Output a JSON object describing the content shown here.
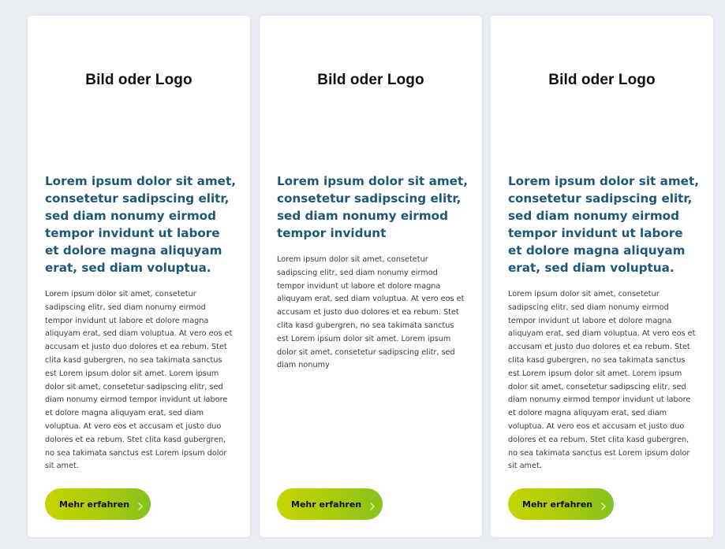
{
  "cards": [
    {
      "logo": "Bild oder Logo",
      "title": "Lorem ipsum dolor sit amet, consetetur sadipscing elitr, sed diam nonumy eirmod tempor invidunt ut labore et dolore magna aliquyam erat, sed diam voluptua.",
      "body": "Lorem ipsum dolor sit amet, consetetur sadipscing elitr, sed diam nonumy eirmod tempor invidunt ut labore et dolore magna aliquyam erat, sed diam voluptua. At vero eos et accusam et justo duo dolores et ea rebum. Stet clita kasd gubergren, no sea takimata sanctus est Lorem ipsum dolor sit amet. Lorem ipsum dolor sit amet, consetetur sadipscing elitr, sed diam nonumy eirmod tempor invidunt ut labore et dolore magna aliquyam erat, sed diam voluptua. At vero eos et accusam et justo duo dolores et ea rebum. Stet clita kasd gubergren, no sea takimata sanctus est Lorem ipsum dolor sit amet.",
      "button": "Mehr erfahren"
    },
    {
      "logo": "Bild oder Logo",
      "title": "Lorem ipsum dolor sit amet, consetetur sadipscing elitr, sed diam nonumy eirmod tempor invidunt",
      "body": "Lorem ipsum dolor sit amet, consetetur sadipscing elitr, sed diam nonumy eirmod tempor invidunt ut labore et dolore magna aliquyam erat, sed diam voluptua. At vero eos et accusam et justo duo dolores et ea rebum. Stet clita kasd gubergren, no sea takimata sanctus est Lorem ipsum dolor sit amet. Lorem ipsum dolor sit amet, consetetur sadipscing elitr, sed diam nonumy",
      "button": "Mehr erfahren"
    },
    {
      "logo": "Bild oder Logo",
      "title": "Lorem ipsum dolor sit amet, consetetur sadipscing elitr, sed diam nonumy eirmod tempor invidunt ut labore et dolore magna aliquyam erat, sed diam voluptua.",
      "body": "Lorem ipsum dolor sit amet, consetetur sadipscing elitr, sed diam nonumy eirmod tempor invidunt ut labore et dolore magna aliquyam erat, sed diam voluptua. At vero eos et accusam et justo duo dolores et ea rebum. Stet clita kasd gubergren, no sea takimata sanctus est Lorem ipsum dolor sit amet. Lorem ipsum dolor sit amet, consetetur sadipscing elitr, sed diam nonumy eirmod tempor invidunt ut labore et dolore magna aliquyam erat, sed diam voluptua. At vero eos et accusam et justo duo dolores et ea rebum. Stet clita kasd gubergren, no sea takimata sanctus est Lorem ipsum dolor sit amet.",
      "button": "Mehr erfahren"
    }
  ],
  "icons": {
    "button_icon": "chevron-right-icon"
  },
  "colors": {
    "page_background": "#e9edf1",
    "card_background": "#ffffff",
    "title_color": "#1d5878",
    "body_color": "#3a3a3a",
    "button_gradient_start": "#c7d400",
    "button_gradient_end": "#86c21d",
    "chevron_color": "#e8f2a0"
  }
}
